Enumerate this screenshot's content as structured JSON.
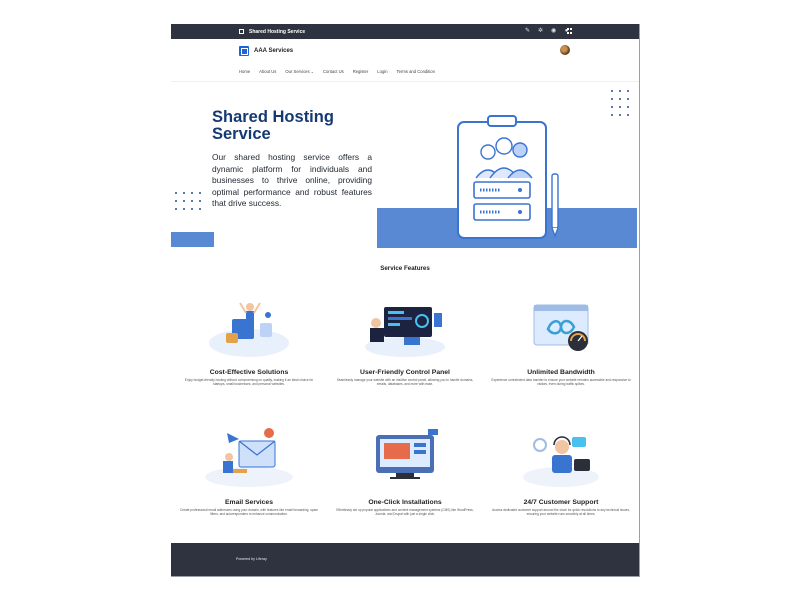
{
  "topbar": {
    "title": "Shared Hosting Service"
  },
  "brand": {
    "name": "AAA Services"
  },
  "nav": {
    "items": [
      "Home",
      "About Us",
      "Our Services",
      "Contact Us",
      "Register",
      "Login",
      "Terms and Condition"
    ]
  },
  "hero": {
    "title": "Shared Hosting Service",
    "description": "Our shared hosting service offers a dynamic platform for individuals and businesses to thrive online, providing optimal performance and robust features that drive success."
  },
  "features": {
    "title": "Service Features",
    "items": [
      {
        "title": "Cost-Effective Solutions",
        "desc": "Enjoy budget-friendly hosting without compromising on quality, making it an ideal choice for startups, small businesses, and personal websites."
      },
      {
        "title": "User-Friendly Control Panel",
        "desc": "Seamlessly manage your website with an intuitive control panel, allowing you to handle domains, emails, databases, and more with ease."
      },
      {
        "title": "Unlimited Bandwidth",
        "desc": "Experience unrestricted data transfer to ensure your website remains accessible and responsive to visitors, even during traffic spikes."
      },
      {
        "title": "Email Services",
        "desc": "Create professional email addresses using your domain, with features like email forwarding, spam filters, and autoresponders to enhance communication."
      },
      {
        "title": "One-Click Installations",
        "desc": "Effortlessly set up popular applications and content management systems (CMS) like WordPress, Joomla, and Drupal with just a single click."
      },
      {
        "title": "24/7 Customer Support",
        "desc": "Access dedicated customer support around the clock for quick resolutions to any technical issues, ensuring your website runs smoothly at all times."
      }
    ]
  },
  "footer": {
    "text": "Powered by Liferay"
  },
  "colors": {
    "accent": "#1e63d9",
    "heading": "#153a73",
    "band": "#5a89d3",
    "bar": "#2f3340"
  }
}
